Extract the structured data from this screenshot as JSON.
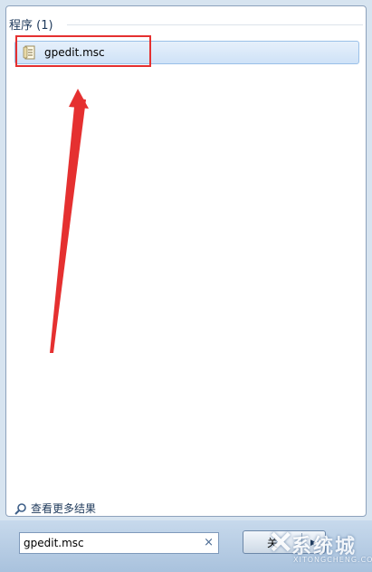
{
  "results": {
    "section_title": "程序 (1)",
    "items": [
      {
        "label": "gpedit.msc",
        "icon": "document-icon"
      }
    ]
  },
  "see_more": {
    "label": "查看更多结果",
    "icon": "search-icon"
  },
  "search": {
    "value": "gpedit.msc",
    "clear_icon": "close-icon",
    "clear_glyph": "×"
  },
  "power": {
    "button_label": "关",
    "arrow_glyph": "▶"
  },
  "watermark": {
    "glyph": "✕",
    "text": "系统城",
    "sub": "XITONGCHENG.COM"
  },
  "colors": {
    "annotation": "#e53030",
    "selection": "#cfe2f7",
    "taskbar": "#a9c2dd"
  }
}
